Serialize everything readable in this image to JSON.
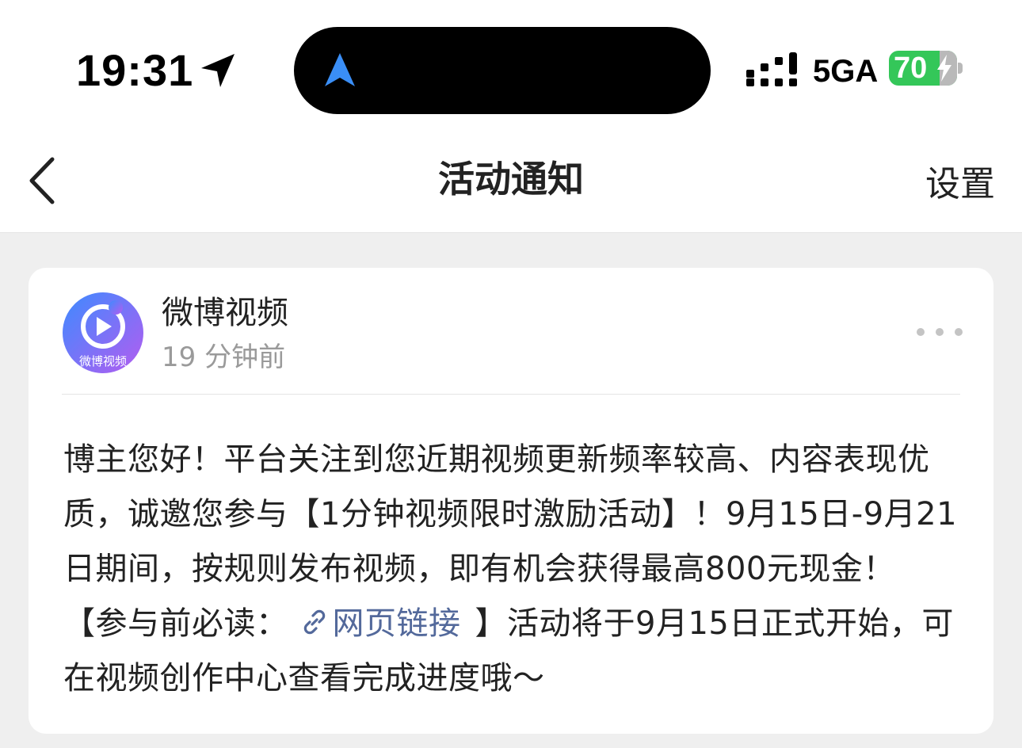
{
  "status_bar": {
    "time": "19:31",
    "network": "5GA",
    "battery_level": "70",
    "battery_color": "#34c759"
  },
  "nav": {
    "title": "活动通知",
    "settings_label": "设置",
    "back_icon": "chevron-left-icon"
  },
  "message": {
    "sender": "微博视频",
    "avatar_label": "微博视频",
    "time": "19 分钟前",
    "more_icon": "more-horizontal-icon",
    "body_part1": "博主您好！平台关注到您近期视频更新频率较高、内容表现优质，诚邀您参与【1分钟视频限时激励活动】！9月15日-9月21日期间，按规则发布视频，即有机会获得最高800元现金！【参与前必读：",
    "link_text": "网页链接",
    "link_color": "#53699b",
    "body_part2": "】活动将于9月15日正式开始，可在视频创作中心查看完成进度哦～"
  }
}
